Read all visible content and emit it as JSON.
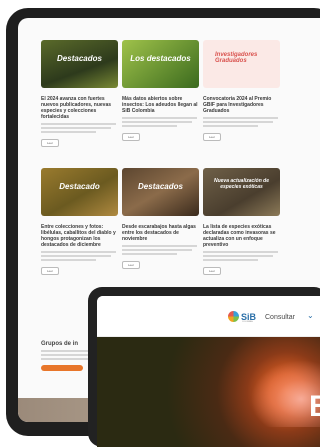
{
  "tablet": {
    "cards": [
      {
        "thumb_text": "Destacados",
        "title": "El 2024 avanza con fuertes nuevos publicadores, nuevas especies y colecciones fortalecidas",
        "read": "Leer"
      },
      {
        "thumb_text": "Los destacados",
        "title": "Más datos abiertos sobre insectos: Los adeudos llegan al SiB Colombia",
        "read": "Leer"
      },
      {
        "thumb_text": "Investigadores Graduados",
        "title": "Convocatoria 2024 al Premio GBIF para Investigadores Graduados",
        "read": "Leer"
      },
      {
        "thumb_text": "Destacado",
        "title": "Entre colecciones y fotos: libélulas, caballitos del diablo y hongos protagonizan los destacados de diciembre",
        "read": "Leer"
      },
      {
        "thumb_text": "Destacados",
        "title": "Desde escarabajos hasta algas entre los destacados de noviembre",
        "read": "Leer"
      },
      {
        "thumb_text": "Nueva actualización de especies exóticas",
        "title": "La lista de especies exóticas declaradas como invasoras se actualiza con un enfoque preventivo",
        "read": "Leer"
      }
    ],
    "groups_title": "Grupos de in"
  },
  "laptop": {
    "logo": "SiB",
    "logo_sub": "COLOMBIA",
    "nav_item": "Consultar",
    "chevron": "⌄",
    "hero_letter": "B"
  },
  "colors": {
    "accent": "#e8762a",
    "brand": "#2a6fa8"
  }
}
